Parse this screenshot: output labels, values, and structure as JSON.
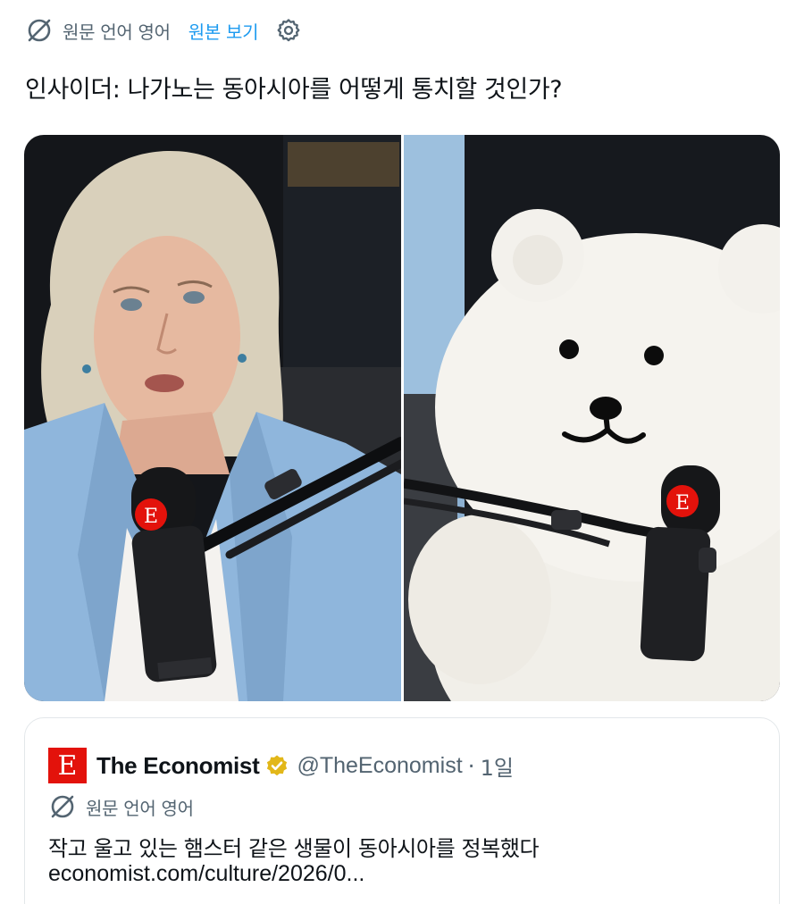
{
  "translation": {
    "note": "원문 언어 영어",
    "show_original": "원본 보기",
    "icon": "translate-icon",
    "settings_icon": "gear-icon"
  },
  "post": {
    "text": "인사이더: 나가노는 동아시아를 어떻게 통치할 것인가?"
  },
  "media": {
    "logo_letter": "E"
  },
  "quoted": {
    "logo_letter": "E",
    "author": "The Economist",
    "handle": "@TheEconomist",
    "separator": "·",
    "age": "1일",
    "translation_note": "원문 언어 영어",
    "text": "작고 울고 있는 햄스터 같은 생물이 동아시아를 정복했다",
    "link": "economist.com/culture/2026/0..."
  },
  "colors": {
    "accent": "#1d9bf0",
    "muted": "#536471",
    "text": "#0f1419",
    "brand_red": "#e3120b",
    "verified_gold": "#e2b719"
  }
}
